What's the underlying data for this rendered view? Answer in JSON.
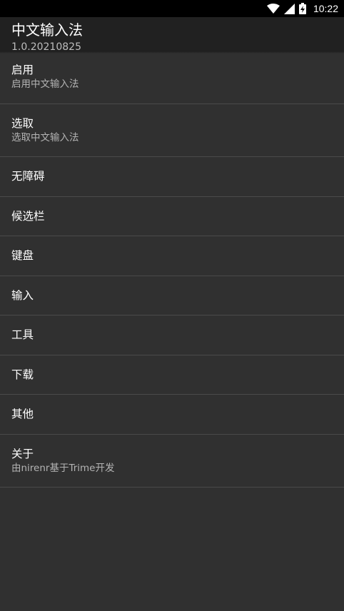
{
  "status_bar": {
    "time": "10:22",
    "icons": [
      "wifi-icon",
      "signal-icon",
      "battery-charging-icon"
    ]
  },
  "app_bar": {
    "title": "中文输入法",
    "subtitle": "1.0.20210825"
  },
  "preferences": [
    {
      "title": "启用",
      "summary": "启用中文输入法"
    },
    {
      "title": "选取",
      "summary": "选取中文输入法"
    },
    {
      "title": "无障碍"
    },
    {
      "title": "候选栏"
    },
    {
      "title": "键盘"
    },
    {
      "title": "输入"
    },
    {
      "title": "工具"
    },
    {
      "title": "下载"
    },
    {
      "title": "其他"
    },
    {
      "title": "关于",
      "summary": "由nirenr基于Trime开发"
    }
  ],
  "colors": {
    "background": "#303030",
    "app_bar": "#212121",
    "divider": "#4a4a4a",
    "summary_text": "#b3b3b3"
  }
}
